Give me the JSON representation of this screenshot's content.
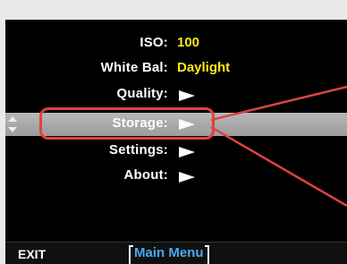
{
  "menu": {
    "iso": {
      "label": "ISO:",
      "value": "100"
    },
    "white_bal": {
      "label": "White Bal:",
      "value": "Daylight"
    },
    "quality": {
      "label": "Quality:"
    },
    "storage": {
      "label": "Storage:"
    },
    "settings": {
      "label": "Settings:"
    },
    "about": {
      "label": "About:"
    }
  },
  "footer": {
    "exit_label": "EXIT",
    "title": "Main Menu"
  },
  "colors": {
    "value": "#ffe818",
    "highlight_bar": "#a8a8a8",
    "callout": "#e04242",
    "title": "#49a9f0"
  },
  "icons": {
    "submenu": "right-triangle-icon",
    "scroll": "up-down-arrows-icon"
  }
}
